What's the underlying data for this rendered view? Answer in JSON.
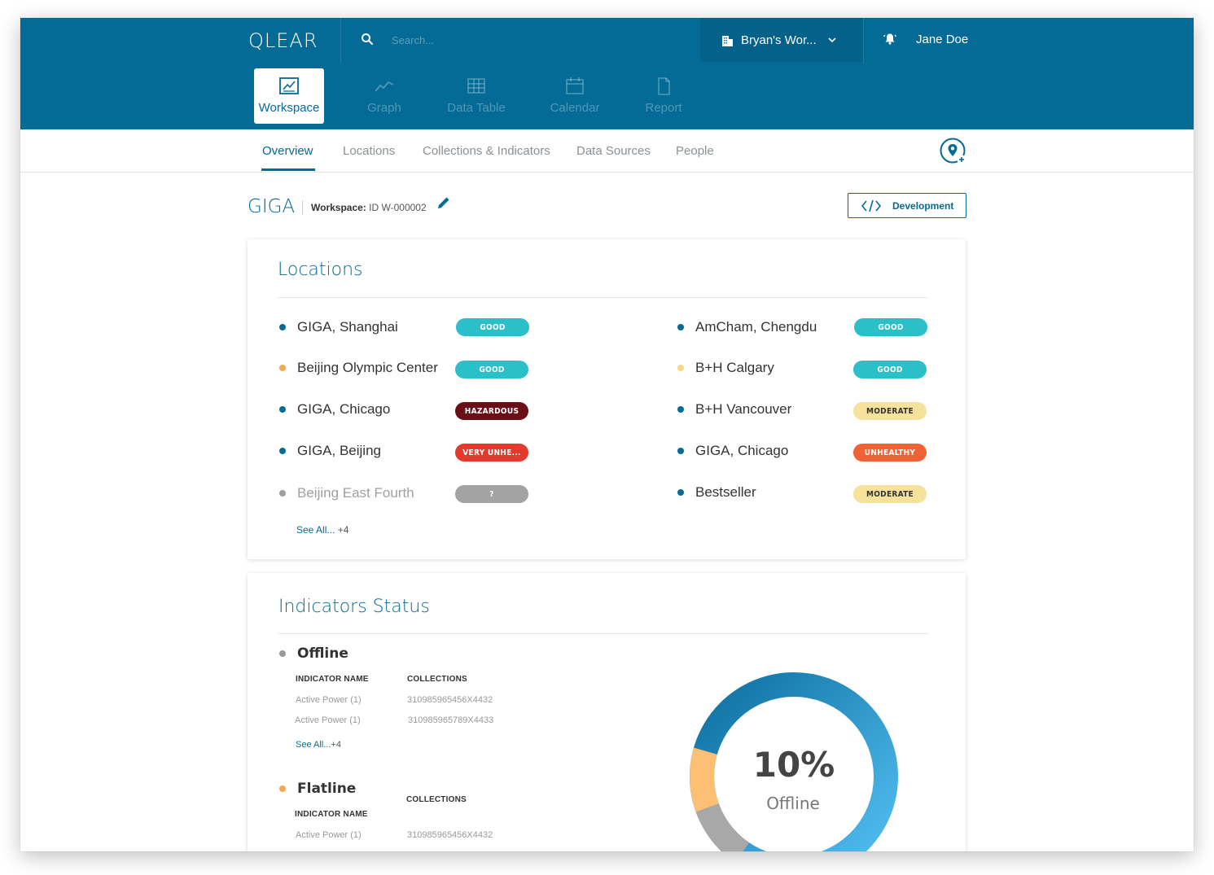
{
  "header": {
    "logo": "QLEAR",
    "search_placeholder": "Search...",
    "workspace_switcher": "Bryan's Wor...",
    "user_name": "Jane Doe"
  },
  "modules": [
    {
      "label": "Workspace",
      "icon": "workspace-chart-icon",
      "active": true
    },
    {
      "label": "Graph",
      "icon": "graph-line-icon",
      "active": false
    },
    {
      "label": "Data Table",
      "icon": "table-grid-icon",
      "active": false
    },
    {
      "label": "Calendar",
      "icon": "calendar-icon",
      "active": false
    },
    {
      "label": "Report",
      "icon": "document-icon",
      "active": false
    }
  ],
  "tabs": [
    {
      "label": "Overview",
      "active": true
    },
    {
      "label": "Locations",
      "active": false
    },
    {
      "label": "Collections & Indicators",
      "active": false
    },
    {
      "label": "Data Sources",
      "active": false
    },
    {
      "label": "People",
      "active": false
    }
  ],
  "page": {
    "title": "GIGA",
    "workspace_label": "Workspace:",
    "workspace_id": "ID W-000002",
    "dev_button": "Development"
  },
  "locations": {
    "title": "Locations",
    "left": [
      {
        "name": "GIGA, Shanghai",
        "dot": "#046a96",
        "status": "GOOD",
        "badge_bg": "#2bbfc9",
        "badge_fg": "#ffffff"
      },
      {
        "name": "Beijing Olympic Center",
        "dot": "#f6a84b",
        "status": "GOOD",
        "badge_bg": "#2bbfc9",
        "badge_fg": "#ffffff"
      },
      {
        "name": "GIGA, Chicago",
        "dot": "#046a96",
        "status": "HAZARDOUS",
        "badge_bg": "#6b0f16",
        "badge_fg": "#ffffff"
      },
      {
        "name": "GIGA, Beijing",
        "dot": "#046a96",
        "status": "VERY UNHE...",
        "badge_bg": "#e23a2c",
        "badge_fg": "#ffffff"
      },
      {
        "name": "Beijing East Fourth",
        "dot": "#a0a0a0",
        "status": "?",
        "badge_bg": "#a3a3a3",
        "badge_fg": "#ffffff",
        "muted": true
      }
    ],
    "right": [
      {
        "name": "AmCham, Chengdu",
        "dot": "#046a96",
        "status": "GOOD",
        "badge_bg": "#2bbfc9",
        "badge_fg": "#ffffff"
      },
      {
        "name": "B+H Calgary",
        "dot": "#f5d98a",
        "status": "GOOD",
        "badge_bg": "#2bbfc9",
        "badge_fg": "#ffffff"
      },
      {
        "name": "B+H Vancouver",
        "dot": "#046a96",
        "status": "MODERATE",
        "badge_bg": "#f7e29c",
        "badge_fg": "#333333"
      },
      {
        "name": "GIGA, Chicago",
        "dot": "#046a96",
        "status": "UNHEALTHY",
        "badge_bg": "#ee6236",
        "badge_fg": "#ffffff"
      },
      {
        "name": "Bestseller",
        "dot": "#046a96",
        "status": "MODERATE",
        "badge_bg": "#f7e29c",
        "badge_fg": "#333333"
      }
    ],
    "see_all": "See All...",
    "see_all_count": "+4"
  },
  "indicators": {
    "title": "Indicators Status",
    "offline": {
      "label": "Offline",
      "dot": "#999999",
      "col_name": "INDICATOR NAME",
      "col_collections": "COLLECTIONS",
      "rows": [
        {
          "name": "Active Power (1)",
          "collection": "310985965456X4432"
        },
        {
          "name": "Active Power (1)",
          "collection": "310985965789X4433"
        }
      ],
      "see_all": "See All...",
      "see_all_count": "+4"
    },
    "flatline": {
      "label": "Flatline",
      "dot": "#f6a84b",
      "col_name": "INDICATOR NAME",
      "col_collections": "COLLECTIONS",
      "rows": [
        {
          "name": "Active Power (1)",
          "collection": "310985965456X4432"
        }
      ]
    },
    "donut": {
      "value": "10%",
      "label": "Offline",
      "segments": [
        {
          "name": "online",
          "fraction": 0.8,
          "color": "#3aa6e0"
        },
        {
          "name": "flatline",
          "fraction": 0.1,
          "color": "#fcbf73"
        },
        {
          "name": "offline",
          "fraction": 0.1,
          "color": "#a8a8a8"
        }
      ]
    }
  },
  "colors": {
    "primary": "#046a96",
    "header_dark": "#03618a"
  }
}
